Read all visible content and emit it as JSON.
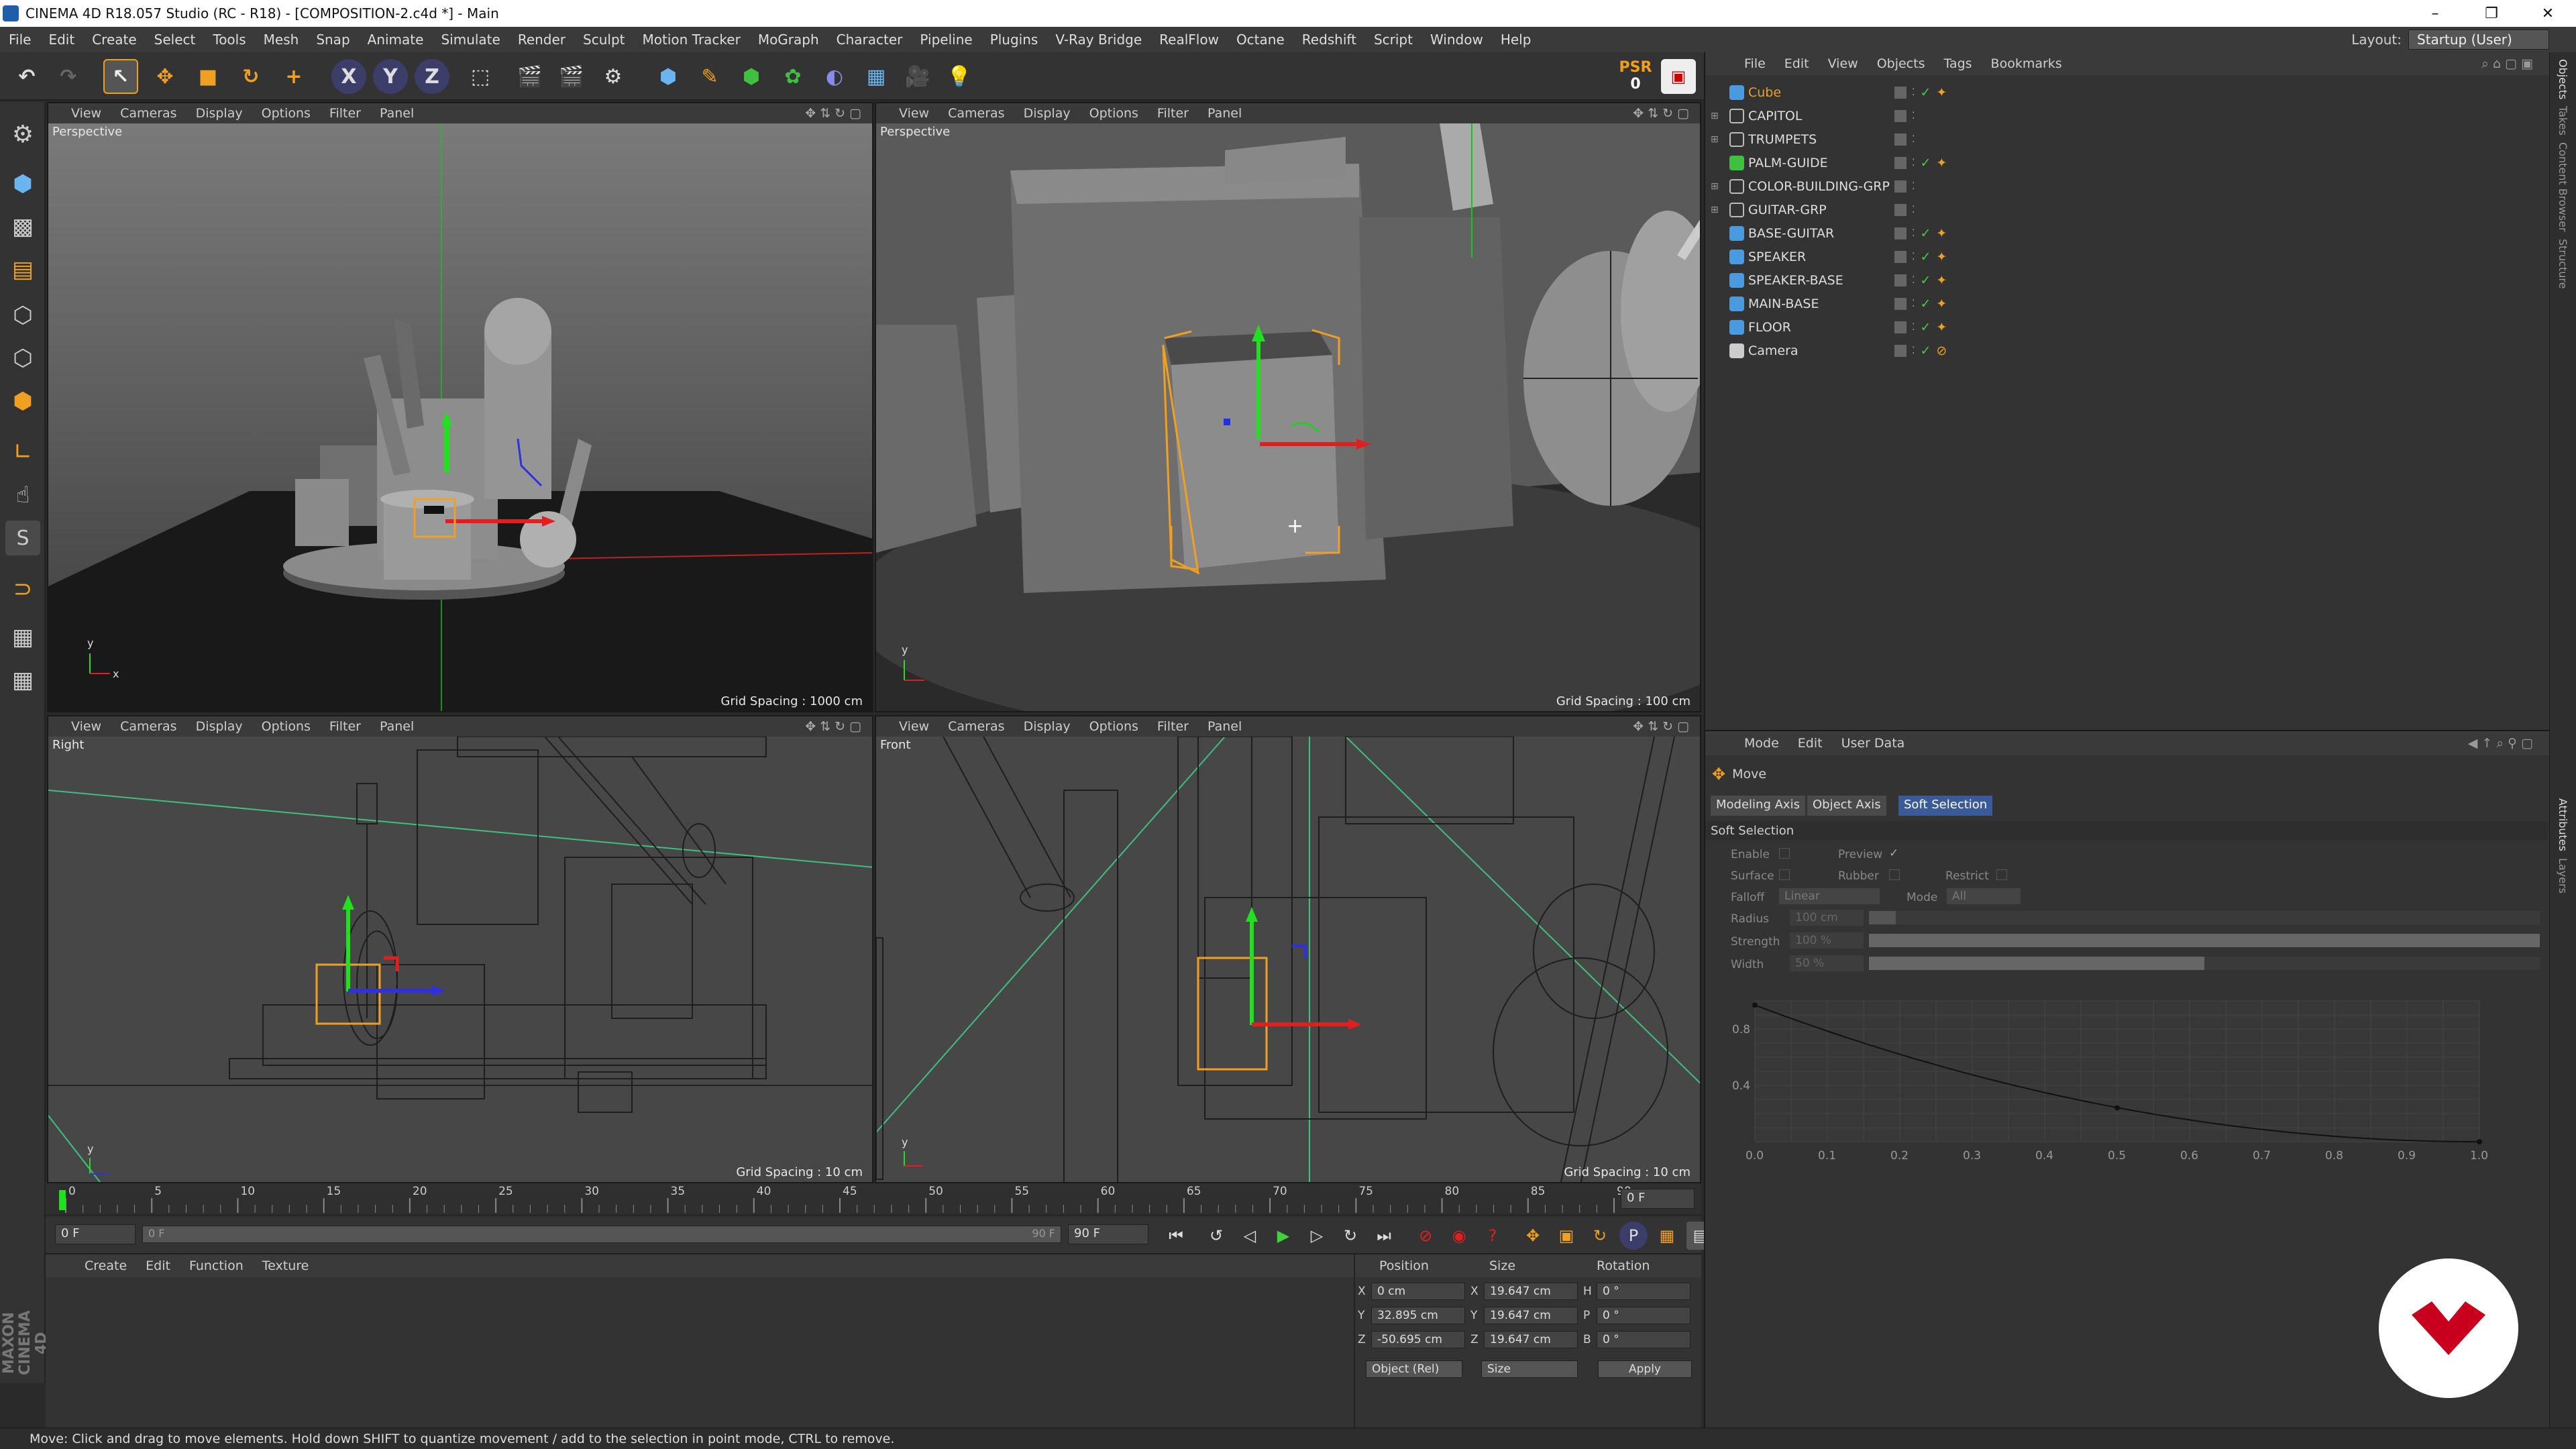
{
  "window": {
    "title": "CINEMA 4D R18.057 Studio (RC - R18) - [COMPOSITION-2.c4d *] - Main",
    "controls": [
      "–",
      "❐",
      "✕"
    ]
  },
  "menu": [
    "File",
    "Edit",
    "Create",
    "Select",
    "Tools",
    "Mesh",
    "Snap",
    "Animate",
    "Simulate",
    "Render",
    "Sculpt",
    "Motion Tracker",
    "MoGraph",
    "Character",
    "Pipeline",
    "Plugins",
    "V-Ray Bridge",
    "RealFlow",
    "Octane",
    "Redshift",
    "Script",
    "Window",
    "Help"
  ],
  "layout": {
    "label": "Layout:",
    "value": "Startup (User)"
  },
  "psr": {
    "label": "PSR",
    "value": "0"
  },
  "viewport_menu": [
    "View",
    "Cameras",
    "Display",
    "Options",
    "Filter",
    "Panel"
  ],
  "viewports": [
    {
      "name": "Perspective",
      "grid": "Grid Spacing : 1000 cm"
    },
    {
      "name": "Perspective",
      "grid": "Grid Spacing : 100 cm"
    },
    {
      "name": "Right",
      "grid": "Grid Spacing : 10 cm"
    },
    {
      "name": "Front",
      "grid": "Grid Spacing : 10 cm"
    }
  ],
  "timeline": {
    "ticks": [
      "0",
      "5",
      "10",
      "15",
      "20",
      "25",
      "30",
      "35",
      "40",
      "45",
      "50",
      "55",
      "60",
      "65",
      "70",
      "75",
      "80",
      "85",
      "90"
    ],
    "end_field": "0 F"
  },
  "transport": {
    "start": "0 F",
    "range_start": "0 F",
    "range_end": "90 F",
    "end": "90 F"
  },
  "material_menu": [
    "Create",
    "Edit",
    "Function",
    "Texture"
  ],
  "coordinates": {
    "headers": [
      "Position",
      "Size",
      "Rotation"
    ],
    "position": [
      {
        "axis": "X",
        "value": "0 cm"
      },
      {
        "axis": "Y",
        "value": "32.895 cm"
      },
      {
        "axis": "Z",
        "value": "-50.695 cm"
      }
    ],
    "size": [
      {
        "axis": "X",
        "value": "19.647 cm"
      },
      {
        "axis": "Y",
        "value": "19.647 cm"
      },
      {
        "axis": "Z",
        "value": "19.647 cm"
      }
    ],
    "rotation": [
      {
        "axis": "H",
        "value": "0 °"
      },
      {
        "axis": "P",
        "value": "0 °"
      },
      {
        "axis": "B",
        "value": "0 °"
      }
    ],
    "mode": "Object (Rel)",
    "size_mode": "Size",
    "apply": "Apply"
  },
  "object_manager": {
    "menu": [
      "File",
      "Edit",
      "View",
      "Objects",
      "Tags",
      "Bookmarks"
    ],
    "objects": [
      {
        "name": "Cube",
        "type": "cube",
        "selected": true
      },
      {
        "name": "CAPITOL",
        "type": "null"
      },
      {
        "name": "TRUMPETS",
        "type": "null"
      },
      {
        "name": "PALM-GUIDE",
        "type": "spline"
      },
      {
        "name": "COLOR-BUILDING-GRP",
        "type": "null"
      },
      {
        "name": "GUITAR-GRP",
        "type": "null"
      },
      {
        "name": "BASE-GUITAR",
        "type": "cube"
      },
      {
        "name": "SPEAKER",
        "type": "cube"
      },
      {
        "name": "SPEAKER-BASE",
        "type": "cube"
      },
      {
        "name": "MAIN-BASE",
        "type": "cube"
      },
      {
        "name": "FLOOR",
        "type": "floor"
      },
      {
        "name": "Camera",
        "type": "camera"
      }
    ]
  },
  "attributes": {
    "menu": [
      "Mode",
      "Edit",
      "User Data"
    ],
    "tool": "Move",
    "tabs": [
      "Modeling Axis",
      "Object Axis",
      "Soft Selection"
    ],
    "active_tab": "Soft Selection",
    "section": "Soft Selection",
    "fields": {
      "enable": "Enable",
      "preview": "Preview",
      "surface": "Surface",
      "rubber": "Rubber",
      "restrict": "Restrict",
      "falloff": "Falloff",
      "falloff_value": "Linear",
      "mode": "Mode",
      "mode_value": "All",
      "radius": "Radius",
      "radius_value": "100 cm",
      "strength": "Strength",
      "strength_value": "100 %",
      "width": "Width",
      "width_value": "50 %"
    },
    "graph_x": [
      "0.0",
      "0.1",
      "0.2",
      "0.3",
      "0.4",
      "0.5",
      "0.6",
      "0.7",
      "0.8",
      "0.9",
      "1.0"
    ],
    "graph_y": [
      "0.8",
      "0.4"
    ]
  },
  "side_tabs": [
    "Objects",
    "Takes",
    "Content Browser",
    "Structure",
    "Attributes",
    "Layers"
  ],
  "status": "Move: Click and drag to move elements. Hold down SHIFT to quantize movement / add to the selection in point mode, CTRL to remove.",
  "branding": {
    "maxon": "MAXON CINEMA 4D"
  },
  "colors": {
    "accent": "#f0a020",
    "x_axis": "#e02020",
    "y_axis": "#20d020",
    "z_axis": "#2040e0",
    "selected_text": "#f0a020",
    "logo_red": "#c8001e"
  }
}
